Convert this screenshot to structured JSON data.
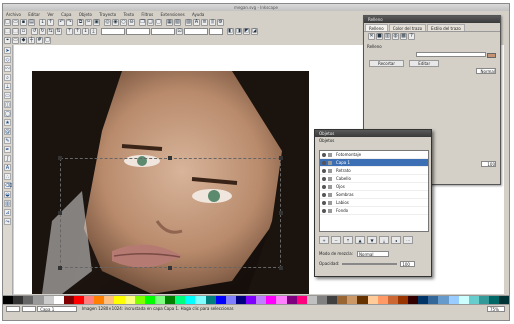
{
  "window": {
    "title": "megan.svg - Inkscape"
  },
  "menus": [
    "Archivo",
    "Editar",
    "Ver",
    "Capa",
    "Objeto",
    "Trayecto",
    "Texto",
    "Filtros",
    "Extensiones",
    "Ayuda"
  ],
  "objects_dialog": {
    "title": "Objetos",
    "items": [
      "Fotomontaje",
      "Capa 1",
      "Retrato",
      "Cabello",
      "Ojos",
      "Sombras",
      "Labios",
      "Fondo"
    ],
    "selected_index": 1,
    "blend_label": "Modo de mezcla:",
    "blend_value": "Normal",
    "opacity_label": "Opacidad:",
    "opacity_value": "100"
  },
  "fill_stroke": {
    "tabs": [
      "Relleno",
      "Color del trazo",
      "Estilo del trazo"
    ],
    "fill_label": "Relleno",
    "fill_color": "#c49374",
    "btn_a": "Recortar",
    "btn_b": "Editar"
  },
  "status": {
    "layer": "Capa 1",
    "message": "Imagen 1280×1024: incrustada en capa Capa 1. Haga clic para seleccionar.",
    "zoom": "75%"
  },
  "palette": [
    "#000000",
    "#333333",
    "#666666",
    "#999999",
    "#cccccc",
    "#ffffff",
    "#7f0000",
    "#ff0000",
    "#ff7f7f",
    "#ff7f00",
    "#ffbf7f",
    "#ffff00",
    "#ffff7f",
    "#7fff00",
    "#00ff00",
    "#7fff7f",
    "#007f00",
    "#00ff7f",
    "#00ffff",
    "#7fffff",
    "#007f7f",
    "#0000ff",
    "#7f7fff",
    "#00007f",
    "#7f00ff",
    "#bf7fff",
    "#ff00ff",
    "#ff7fff",
    "#7f007f",
    "#ff007f",
    "#c0c0c0",
    "#808080",
    "#404040",
    "#996633",
    "#cc9966",
    "#663300",
    "#ffcc99",
    "#ff9966",
    "#cc6633",
    "#993300",
    "#330000",
    "#003366",
    "#336699",
    "#6699cc",
    "#99ccff",
    "#ccffff",
    "#66cccc",
    "#339999",
    "#006666",
    "#003333"
  ],
  "colors": {
    "accent": "#3d6fb5"
  }
}
